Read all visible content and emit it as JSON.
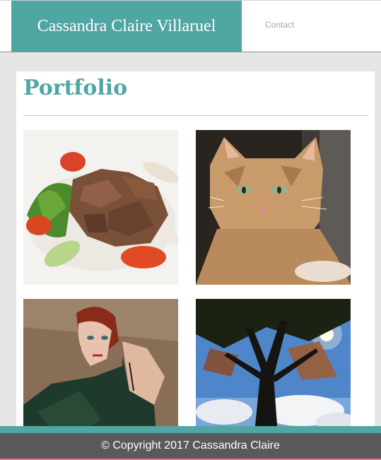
{
  "header": {
    "site_name": "Cassandra Claire Villaruel",
    "nav": {
      "contact_label": "Contact"
    }
  },
  "main": {
    "title": "Portfolio",
    "gallery": [
      {
        "subject": "grilled steak salad"
      },
      {
        "subject": "orange tabby cat"
      },
      {
        "subject": "red-haired woman portrait"
      },
      {
        "subject": "tree against sky"
      }
    ]
  },
  "footer": {
    "copyright": "© Copyright 2017 Cassandra Claire"
  },
  "colors": {
    "accent": "#4fa6a2",
    "footer_bg": "#5a5a5a",
    "page_bg": "#e6e6e6"
  }
}
